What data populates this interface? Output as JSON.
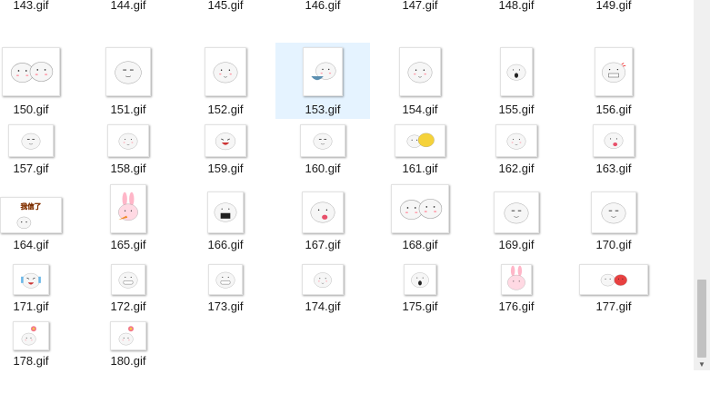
{
  "files": [
    {
      "name": "143.gif",
      "kind": "cloud"
    },
    {
      "name": "144.gif",
      "kind": "bun"
    },
    {
      "name": "145.gif",
      "kind": "blush"
    },
    {
      "name": "146.gif",
      "kind": "yellow"
    },
    {
      "name": "147.gif",
      "kind": "sign"
    },
    {
      "name": "148.gif",
      "kind": "dark"
    },
    {
      "name": "149.gif",
      "kind": "bunny"
    },
    {
      "name": "150.gif",
      "kind": "pair"
    },
    {
      "name": "151.gif",
      "kind": "bun"
    },
    {
      "name": "152.gif",
      "kind": "blush"
    },
    {
      "name": "153.gif",
      "kind": "bowl",
      "selected": true
    },
    {
      "name": "154.gif",
      "kind": "blush"
    },
    {
      "name": "155.gif",
      "kind": "shock"
    },
    {
      "name": "156.gif",
      "kind": "angry"
    },
    {
      "name": "157.gif",
      "kind": "bun"
    },
    {
      "name": "158.gif",
      "kind": "blush"
    },
    {
      "name": "159.gif",
      "kind": "laugh"
    },
    {
      "name": "160.gif",
      "kind": "bun"
    },
    {
      "name": "161.gif",
      "kind": "yellowpair"
    },
    {
      "name": "162.gif",
      "kind": "blush"
    },
    {
      "name": "163.gif",
      "kind": "tongue"
    },
    {
      "name": "164.gif",
      "kind": "text",
      "text": "我信了"
    },
    {
      "name": "165.gif",
      "kind": "bunnycarrot"
    },
    {
      "name": "166.gif",
      "kind": "shout"
    },
    {
      "name": "167.gif",
      "kind": "tongue"
    },
    {
      "name": "168.gif",
      "kind": "pair"
    },
    {
      "name": "169.gif",
      "kind": "bun"
    },
    {
      "name": "170.gif",
      "kind": "bun"
    },
    {
      "name": "171.gif",
      "kind": "cry"
    },
    {
      "name": "172.gif",
      "kind": "grin"
    },
    {
      "name": "173.gif",
      "kind": "grin"
    },
    {
      "name": "174.gif",
      "kind": "blush"
    },
    {
      "name": "175.gif",
      "kind": "shock"
    },
    {
      "name": "176.gif",
      "kind": "bunny"
    },
    {
      "name": "177.gif",
      "kind": "redpair"
    },
    {
      "name": "178.gif",
      "kind": "flower"
    },
    {
      "name": "180.gif",
      "kind": "flower"
    }
  ],
  "colors": {
    "selection": "#e5f3ff",
    "blush": "#ff9aa8",
    "bunny": "#ffb6c8",
    "yellow": "#f5d23a"
  }
}
